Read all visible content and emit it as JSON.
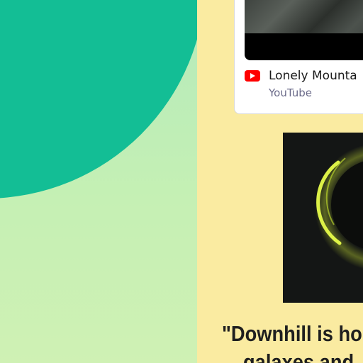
{
  "embed": {
    "title": "Lonely Mounta",
    "provider": "YouTube",
    "icon": "youtube-logo-icon",
    "brand_color": "#ff0000"
  },
  "article": {
    "quote_line1": "\"Downhill is ho",
    "quote_line2": "galaxes and"
  },
  "colors": {
    "left_background": "#c5f0b4",
    "blob": "#13be95",
    "right_panel": "#faeba1",
    "eclipse_ring": "#d8f23a"
  }
}
